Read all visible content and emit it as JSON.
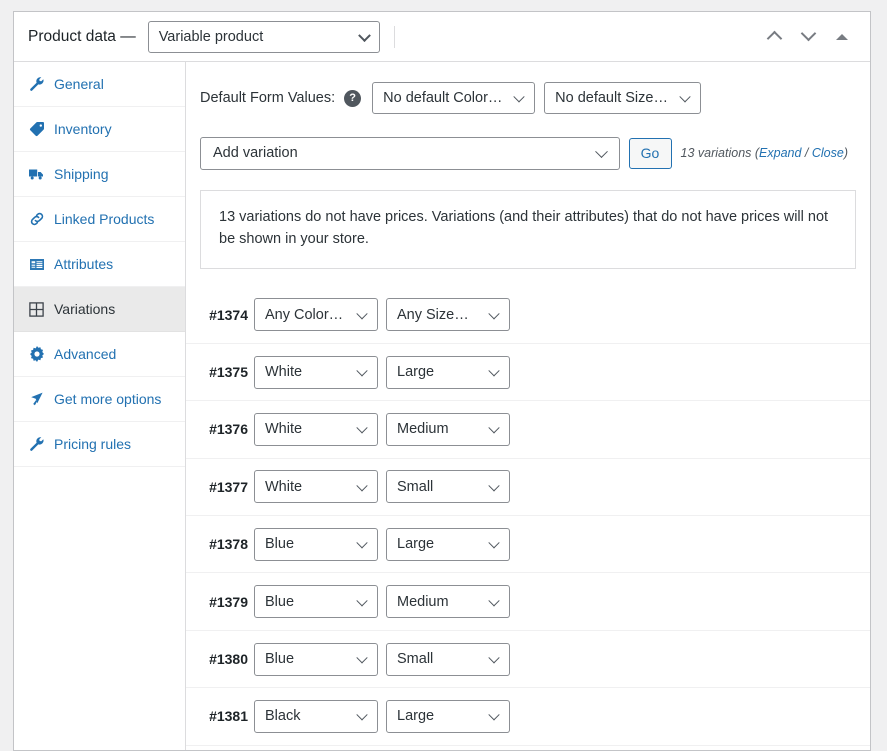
{
  "header": {
    "title": "Product data —",
    "product_type": "Variable product",
    "move_up_icon": "chevron-up-icon",
    "move_down_icon": "chevron-down-icon",
    "collapse_icon": "triangle-up-icon"
  },
  "sidebar": {
    "items": [
      {
        "label": "General",
        "icon": "wrench-icon",
        "active": false
      },
      {
        "label": "Inventory",
        "icon": "tag-icon",
        "active": false
      },
      {
        "label": "Shipping",
        "icon": "truck-icon",
        "active": false
      },
      {
        "label": "Linked Products",
        "icon": "link-icon",
        "active": false
      },
      {
        "label": "Attributes",
        "icon": "list-icon",
        "active": false
      },
      {
        "label": "Variations",
        "icon": "grid-icon",
        "active": true
      },
      {
        "label": "Advanced",
        "icon": "gear-icon",
        "active": false
      },
      {
        "label": "Get more options",
        "icon": "cursor-icon",
        "active": false
      },
      {
        "label": "Pricing rules",
        "icon": "wrench-icon",
        "active": false
      }
    ]
  },
  "default_form_values": {
    "label": "Default Form Values:",
    "help_icon": "help-icon",
    "help_glyph": "?",
    "color_value": "No default Color…",
    "size_value": "No default Size…"
  },
  "toolbar": {
    "add_variation_value": "Add variation",
    "go_label": "Go",
    "count_text": "13 variations",
    "expand_label": "Expand",
    "separator": " / ",
    "close_label": "Close",
    "open_paren": " (",
    "close_paren": ")"
  },
  "notice": {
    "text": "13 variations do not have prices. Variations (and their attributes) that do not have prices will not be shown in your store."
  },
  "variations": {
    "rows": [
      {
        "id": "#1374",
        "color": "Any Color…",
        "size": "Any Size…"
      },
      {
        "id": "#1375",
        "color": "White",
        "size": "Large"
      },
      {
        "id": "#1376",
        "color": "White",
        "size": "Medium"
      },
      {
        "id": "#1377",
        "color": "White",
        "size": "Small"
      },
      {
        "id": "#1378",
        "color": "Blue",
        "size": "Large"
      },
      {
        "id": "#1379",
        "color": "Blue",
        "size": "Medium"
      },
      {
        "id": "#1380",
        "color": "Blue",
        "size": "Small"
      },
      {
        "id": "#1381",
        "color": "Black",
        "size": "Large"
      }
    ]
  },
  "colors": {
    "link": "#2271b1",
    "page_bg": "#f0f0f1",
    "panel_border": "#c3c4c7",
    "active_tab_bg": "#eaeaea",
    "text": "#2c3338"
  }
}
